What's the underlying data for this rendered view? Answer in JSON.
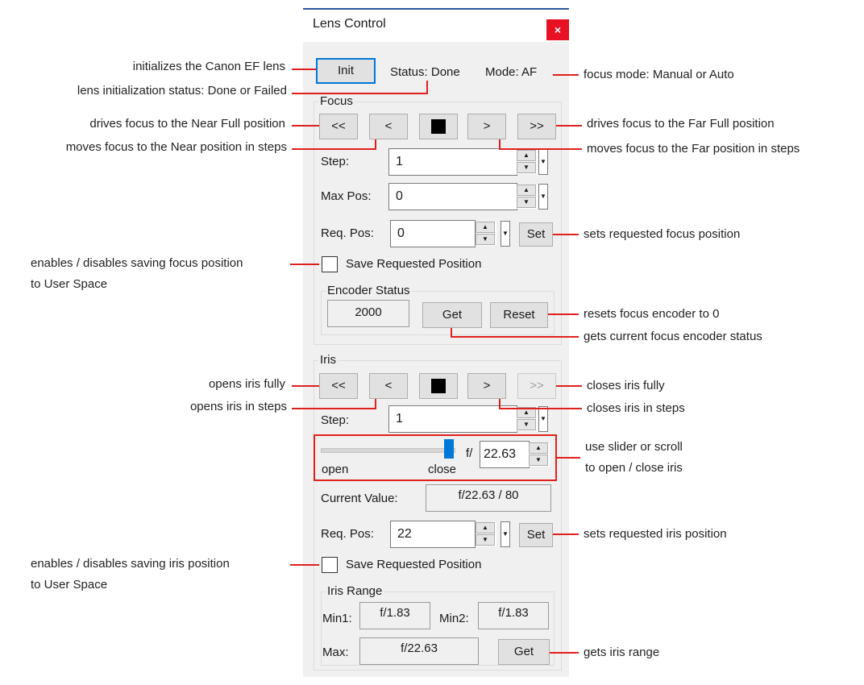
{
  "window": {
    "title": "Lens Control",
    "close_label": "×"
  },
  "top": {
    "init_label": "Init",
    "status_text": "Status: Done",
    "mode_text": "Mode:  AF"
  },
  "focus": {
    "group_label": "Focus",
    "buttons": {
      "near_full": "<<",
      "near_step": "<",
      "far_step": ">",
      "far_full": ">>"
    },
    "step_label": "Step:",
    "step_value": "1",
    "max_pos_label": "Max Pos:",
    "max_pos_value": "0",
    "req_pos_label": "Req. Pos:",
    "req_pos_value": "0",
    "set_label": "Set",
    "save_label": "Save Requested Position",
    "encoder": {
      "group_label": "Encoder Status",
      "value": "2000",
      "get_label": "Get",
      "reset_label": "Reset"
    }
  },
  "iris": {
    "group_label": "Iris",
    "buttons": {
      "open_full": "<<",
      "open_step": "<",
      "close_step": ">",
      "close_full": ">>"
    },
    "step_label": "Step:",
    "step_value": "1",
    "slider": {
      "open_label": "open",
      "close_label": "close",
      "f_prefix": "f/",
      "f_value": "22.63",
      "position_fraction": 1.0
    },
    "current_label": "Current Value:",
    "current_value": "f/22.63 / 80",
    "req_pos_label": "Req. Pos:",
    "req_pos_value": "22",
    "set_label": "Set",
    "save_label": "Save Requested Position",
    "range": {
      "group_label": "Iris Range",
      "min1_label": "Min1:",
      "min1_value": "f/1.83",
      "min2_label": "Min2:",
      "min2_value": "f/1.83",
      "max_label": "Max:",
      "max_value": "f/22.63",
      "get_label": "Get"
    }
  },
  "annotations": {
    "init": "initializes the Canon EF lens",
    "status": "lens initialization status: Done or Failed",
    "mode": "focus mode: Manual or Auto",
    "near_full": "drives focus to the Near Full position",
    "near_step": "moves focus to the Near position in steps",
    "far_full": "drives focus to the Far Full position",
    "far_step": "moves focus to the Far position in steps",
    "focus_set": "sets requested focus position",
    "focus_save_1": "enables / disables saving focus position",
    "focus_save_2": "to User Space",
    "reset": "resets focus encoder to 0",
    "get": "gets current focus encoder status",
    "iris_open_full": "opens iris fully",
    "iris_open_step": "opens iris in steps",
    "iris_close_full": "closes iris fully",
    "iris_close_step": "closes iris in steps",
    "slider_1": "use slider or scroll",
    "slider_2": "to open / close iris",
    "iris_set": "sets requested iris position",
    "iris_save_1": "enables / disables saving iris position",
    "iris_save_2": "to User Space",
    "iris_range": "gets iris range"
  },
  "colors": {
    "annotation_line": "#e0201c",
    "accent": "#0078d7",
    "close_button": "#e81123"
  }
}
